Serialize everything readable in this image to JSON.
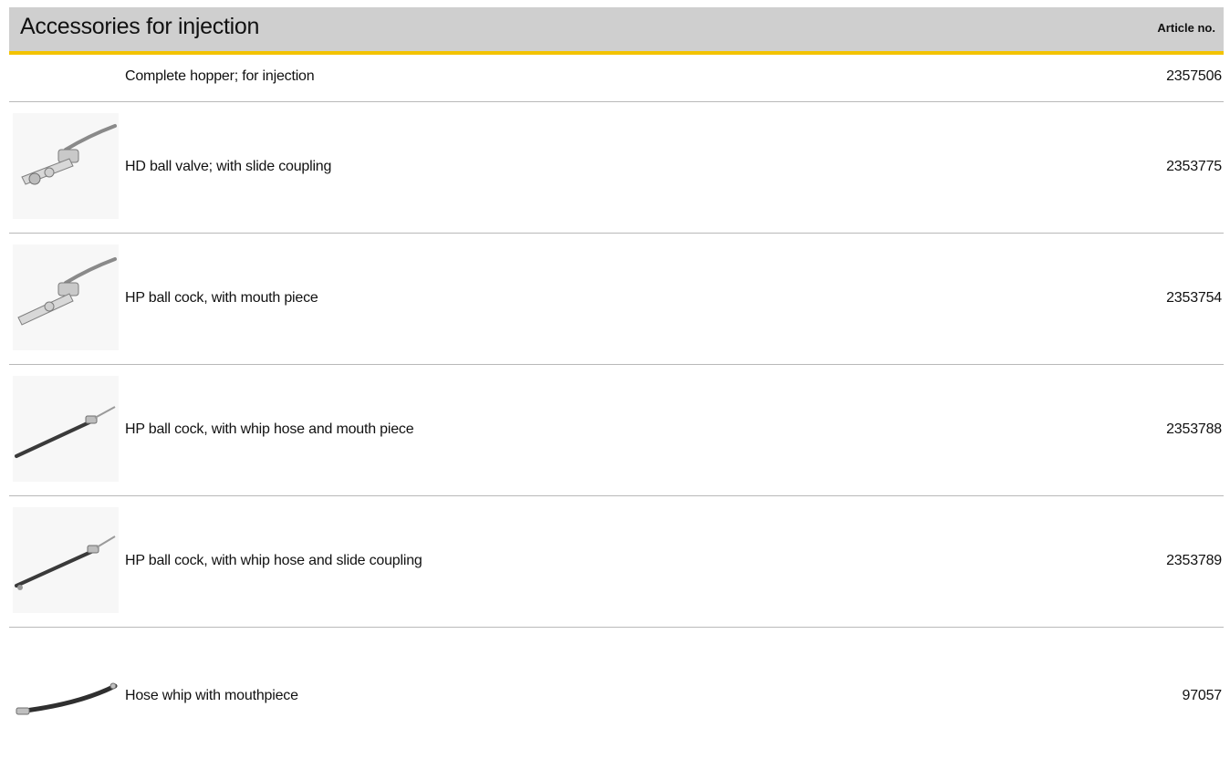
{
  "header": {
    "title": "Accessories for injection",
    "article_col": "Article no."
  },
  "rows": [
    {
      "description": "Complete hopper; for injection",
      "article_no": "2357506",
      "icon": "none"
    },
    {
      "description": "HD ball valve; with slide coupling",
      "article_no": "2353775",
      "icon": "ball-valve-icon"
    },
    {
      "description": "HP ball cock, with mouth piece",
      "article_no": "2353754",
      "icon": "ball-cock-icon"
    },
    {
      "description": "HP ball cock, with whip hose and mouth piece",
      "article_no": "2353788",
      "icon": "whip-hose-ball-cock-icon"
    },
    {
      "description": "HP ball cock, with whip hose and slide coupling",
      "article_no": "2353789",
      "icon": "whip-hose-ball-cock-icon"
    },
    {
      "description": "Hose whip with mouthpiece",
      "article_no": "97057",
      "icon": "hose-whip-icon"
    }
  ],
  "colors": {
    "header_bg": "#cfcfcf",
    "accent": "#f3c300",
    "divider": "#b9b9b9"
  }
}
